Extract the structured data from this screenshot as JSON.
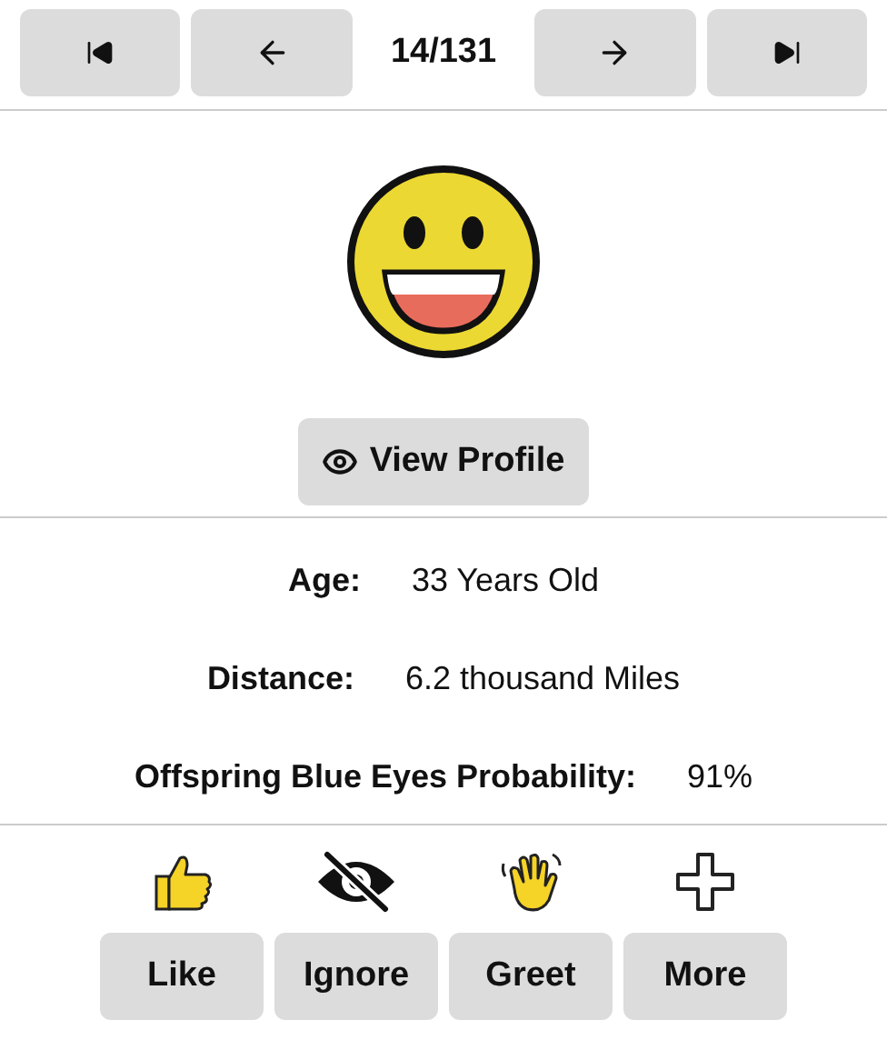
{
  "pager": {
    "position": "14/131"
  },
  "profile_button": {
    "label": "View Profile"
  },
  "fields": [
    {
      "label": "Age:",
      "value": "33 Years Old"
    },
    {
      "label": "Distance:",
      "value": "6.2 thousand Miles"
    },
    {
      "label": "Offspring Blue Eyes Probability:",
      "value": "91%"
    }
  ],
  "actions": [
    {
      "kind": "like",
      "label": "Like"
    },
    {
      "kind": "ignore",
      "label": "Ignore"
    },
    {
      "kind": "greet",
      "label": "Greet"
    },
    {
      "kind": "more",
      "label": "More"
    }
  ]
}
